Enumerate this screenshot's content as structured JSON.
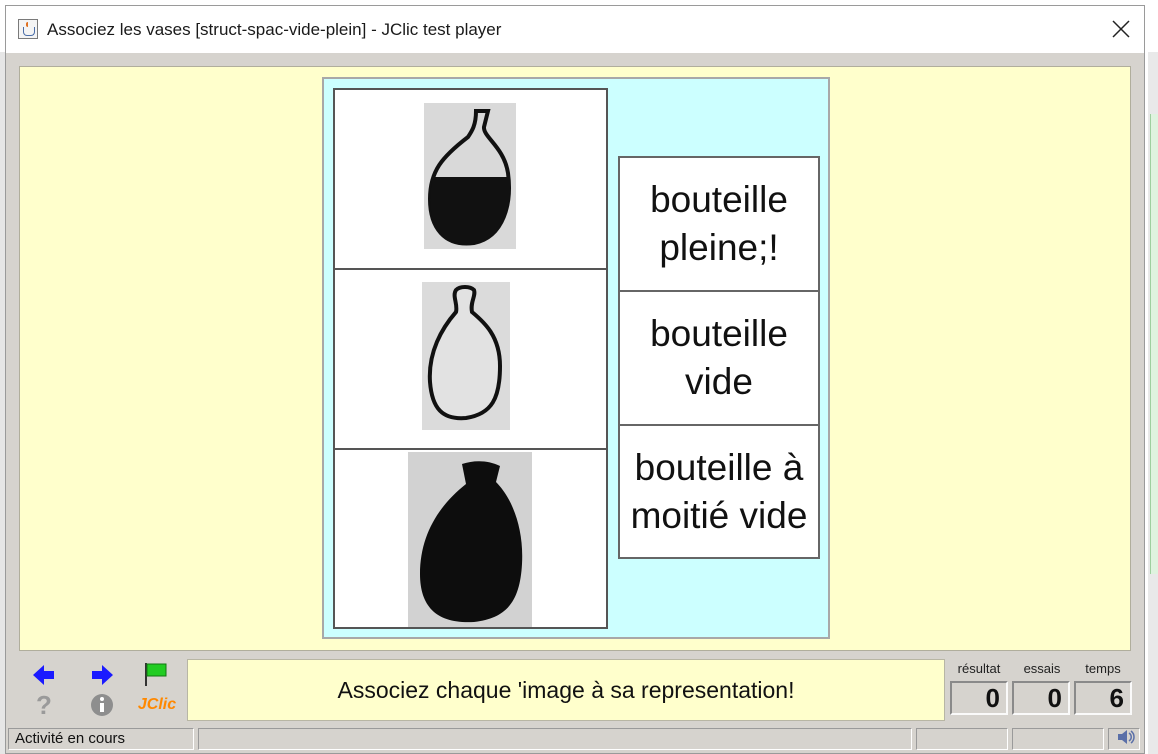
{
  "window": {
    "title": "Associez les vases [struct-spac-vide-plein] - JClic test player"
  },
  "images": [
    "bottle-half-full",
    "bottle-empty",
    "bottle-full"
  ],
  "labels": [
    {
      "line1": "bouteille",
      "line2": "pleine;!"
    },
    {
      "line1": "bouteille",
      "line2": "vide"
    },
    {
      "line1": "bouteille à",
      "line2": "moitié vide"
    }
  ],
  "controls": {
    "icons": [
      "arrow-left-icon",
      "arrow-right-icon",
      "flag-icon",
      "help-icon",
      "info-icon",
      "jclic-logo"
    ],
    "jclic_text": "JClic",
    "help_text": "?",
    "info_text": "i"
  },
  "message": "Associez chaque 'image à sa representation!",
  "counters": [
    {
      "label": "résultat",
      "value": "0"
    },
    {
      "label": "essais",
      "value": "0"
    },
    {
      "label": "temps",
      "value": "6"
    }
  ],
  "status": {
    "text": "Activité en cours"
  },
  "colors": {
    "activity_bg": "#ffffcc",
    "board_bg": "#ccffff",
    "nav_arrow": "#1a1aff",
    "flag": "#22cc22",
    "jclic": "#ff8800"
  }
}
